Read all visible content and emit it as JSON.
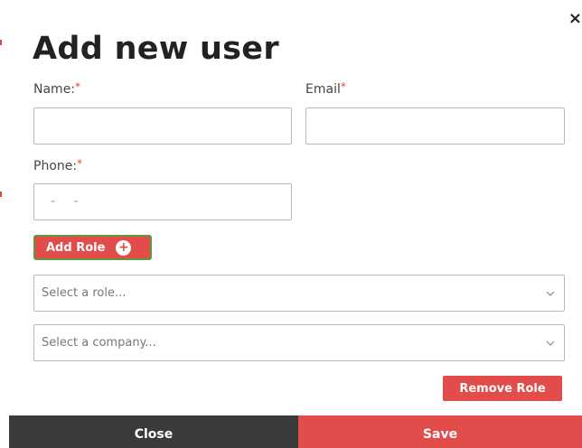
{
  "modal": {
    "title": "Add new user",
    "close_glyph": "×",
    "close_icon": "close-icon"
  },
  "form": {
    "name": {
      "label": "Name:",
      "required_mark": "*",
      "value": "",
      "placeholder": ""
    },
    "email": {
      "label": "Email",
      "required_mark": "*",
      "value": "",
      "placeholder": ""
    },
    "phone": {
      "label": "Phone:",
      "required_mark": "*",
      "mask": "- -",
      "value": ""
    }
  },
  "roles": {
    "add_role_label": "Add Role",
    "add_role_icon": "plus-circle-icon",
    "plus_glyph": "+",
    "role_select_placeholder": "Select a role...",
    "company_select_placeholder": "Select a company...",
    "chevron_icon": "chevron-down-icon",
    "remove_role_label": "Remove Role"
  },
  "footer": {
    "close_label": "Close",
    "save_label": "Save"
  },
  "colors": {
    "accent": "#e24c4a",
    "footer_dark": "#3a3a3a",
    "add_role_border": "#5c9a3d",
    "required_mark": "#e0463f"
  }
}
